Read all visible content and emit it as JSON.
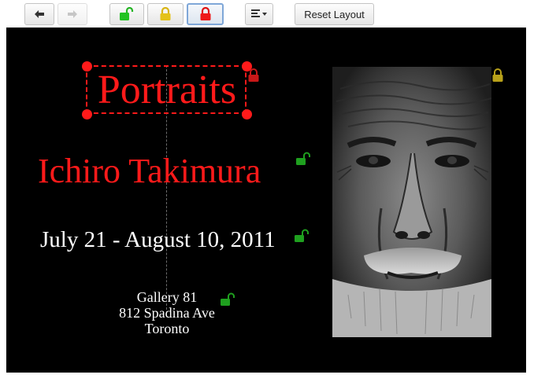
{
  "toolbar": {
    "back_icon": "arrow-left-icon",
    "forward_icon": "arrow-right-icon",
    "unlock_icon": "unlocked-padlock-icon",
    "partial_lock_icon": "padlock-yellow-icon",
    "lock_icon": "padlock-red-icon",
    "align_icon": "align-left-icon",
    "reset_label": "Reset Layout"
  },
  "canvas": {
    "title": "Portraits",
    "artist": "Ichiro Takimura",
    "dates": "July 21 - August 10, 2011",
    "venue_lines": [
      "Gallery 81",
      "812 Spadina Ave",
      "Toronto"
    ],
    "photo_icon": "portrait-photo"
  },
  "colors": {
    "title": "#ff1a1a",
    "artist": "#ff1a1a",
    "dates": "#ffffff",
    "venue": "#ffffff",
    "unlock": "#2aa52a",
    "partial_lock": "#b8a11a",
    "lock": "#d21a1a",
    "stage_bg": "#000000"
  }
}
